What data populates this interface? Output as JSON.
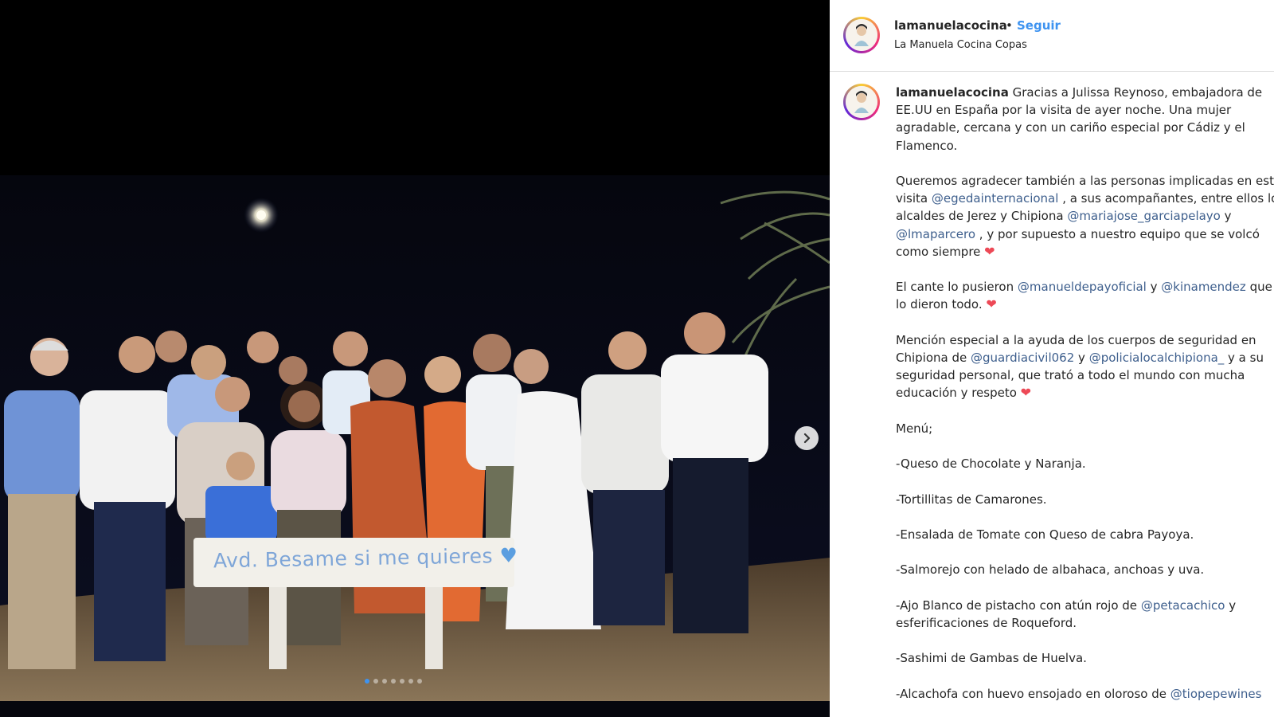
{
  "media": {
    "sign_text": "Avd. Besame si me quieres",
    "sign_heart": "♥",
    "next_icon": "chevron-right-icon",
    "carousel": {
      "count": 7,
      "active": 0
    }
  },
  "post": {
    "username": "lamanuelacocina",
    "separator": "•",
    "follow_label": "Seguir",
    "location": "La Manuela Cocina Copas"
  },
  "caption": {
    "username": "lamanuelacocina",
    "heart": "❤",
    "p1_l1": " Gracias a Julissa Reynoso, embajadora de",
    "p1_l2": "EE.UU en España por la visita de ayer noche. Una mujer",
    "p1_l3": "agradable, cercana y con un cariño especial por Cádiz y el",
    "p1_l4": "Flamenco.",
    "p2_l1": "Queremos agradecer también a las personas implicadas en est",
    "p2_l2a": "visita ",
    "p2_l2m": "@egedainternacional",
    "p2_l2b": " , a sus acompañantes, entre ellos lo",
    "p2_l3a": "alcaldes de Jerez y Chipiona ",
    "p2_l3m": "@mariajose_garciapelayo",
    "p2_l3b": " y",
    "p2_l4m": "@lmaparcero",
    "p2_l4b": " , y por supuesto a nuestro equipo que se volcó",
    "p2_l5": "como siempre ",
    "p3_l1a": "El cante lo pusieron ",
    "p3_l1m1": "@manueldepayoficial",
    "p3_l1b": " y ",
    "p3_l1m2": "@kinamendez",
    "p3_l1c": " que",
    "p3_l2": "lo dieron todo. ",
    "p4_l1": "Mención especial a la ayuda de los cuerpos de seguridad en",
    "p4_l2a": "Chipiona de ",
    "p4_l2m1": "@guardiacivil062",
    "p4_l2b": " y ",
    "p4_l2m2": "@policialocalchipiona_",
    "p4_l2c": " y a su",
    "p4_l3": "seguridad personal, que trató a todo el mundo con mucha",
    "p4_l4": "educación y respeto ",
    "menu_title": "Menú;",
    "item1": "-Queso de Chocolate y Naranja.",
    "item2": "-Tortillitas de Camarones.",
    "item3": "-Ensalada de Tomate con Queso de cabra Payoya.",
    "item4": "-Salmorejo con helado de albahaca, anchoas y uva.",
    "item5_l1a": "-Ajo Blanco de pistacho con atún rojo de ",
    "item5_l1m": "@petacachico",
    "item5_l1b": " y",
    "item5_l2": "esferificaciones de Roqueford.",
    "item6": "-Sashimi de Gambas de Huelva.",
    "item7a": "-Alcachofa con huevo ensojado en oloroso de ",
    "item7m": "@tiopepewines"
  }
}
